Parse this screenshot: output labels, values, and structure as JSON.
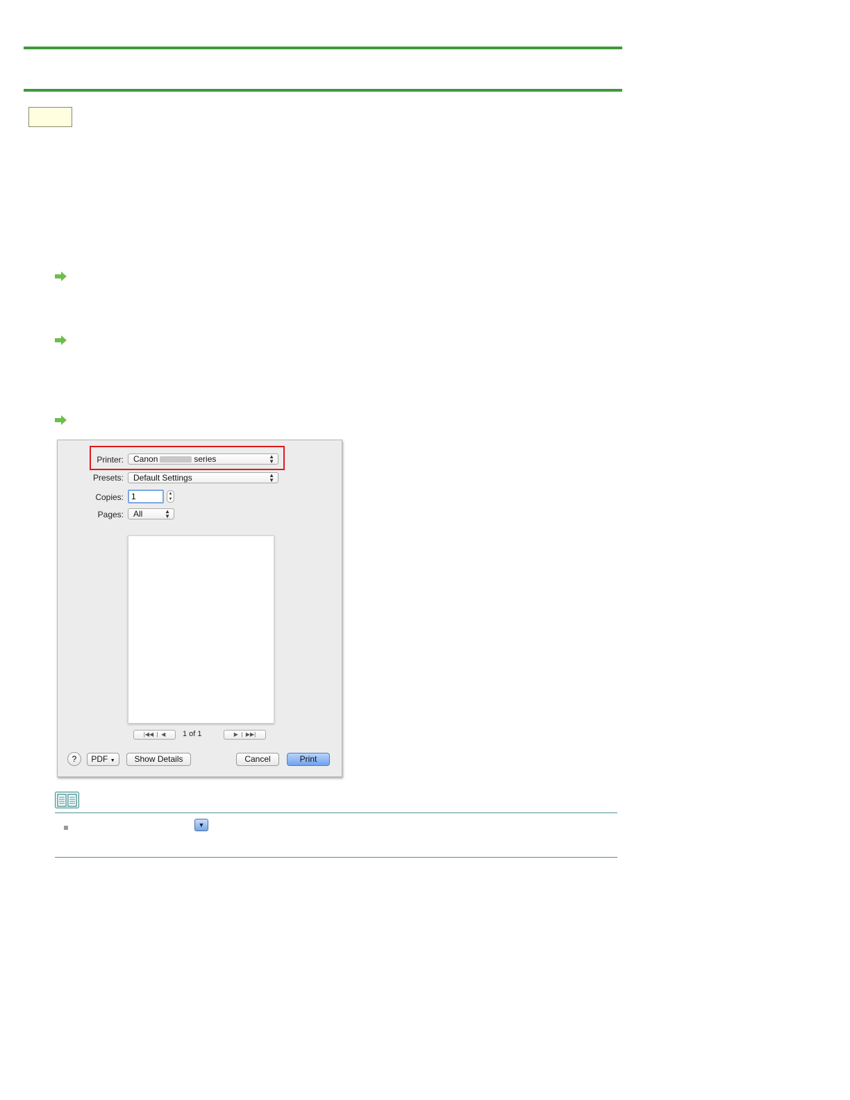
{
  "dialog": {
    "printer_label": "Printer:",
    "printer_value_prefix": "Canon",
    "printer_value_suffix": "series",
    "presets_label": "Presets:",
    "presets_value": "Default Settings",
    "copies_label": "Copies:",
    "copies_value": "1",
    "pages_label": "Pages:",
    "pages_value": "All",
    "page_count": "1 of 1",
    "pdf_label": "PDF",
    "show_details_label": "Show Details",
    "cancel_label": "Cancel",
    "print_label": "Print",
    "help_label": "?"
  },
  "colors": {
    "rule_green": "#3f9a3a",
    "arrow_green": "#6cc04a",
    "highlight_red": "#e0181e",
    "note_line": "#4f8f8f"
  }
}
